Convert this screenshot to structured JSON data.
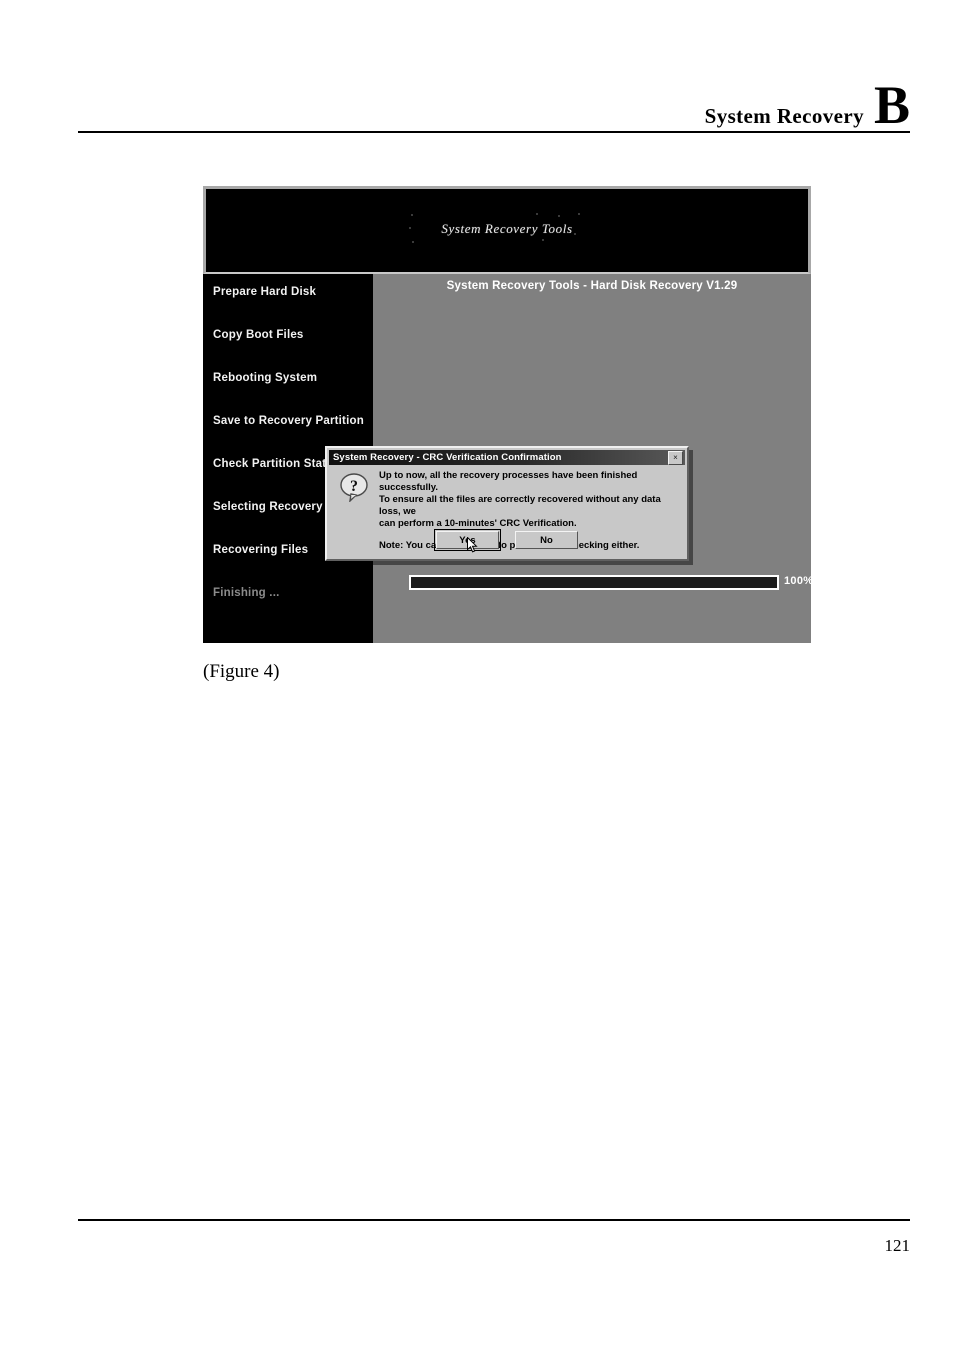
{
  "page": {
    "chapter_title": "System Recovery",
    "chapter_letter": "B",
    "figure_caption": "(Figure 4)",
    "page_number": "121"
  },
  "screenshot": {
    "banner_title": "System Recovery Tools",
    "content_heading": "System Recovery Tools - Hard Disk Recovery V1.29",
    "steps": [
      {
        "label": "Prepare Hard Disk",
        "state": "done"
      },
      {
        "label": "Copy Boot Files",
        "state": "done"
      },
      {
        "label": "Rebooting System",
        "state": "done"
      },
      {
        "label": "Save to Recovery Partition",
        "state": "done"
      },
      {
        "label": "Check Partition Status",
        "state": "done"
      },
      {
        "label": "Selecting Recovery Options",
        "state": "done"
      },
      {
        "label": "Recovering Files",
        "state": "done"
      },
      {
        "label": "Finishing ...",
        "state": "pending"
      }
    ],
    "progress": {
      "percent": 100,
      "label": "100%"
    },
    "dialog": {
      "title": "System Recovery - CRC Verification Confirmation",
      "close_label": "×",
      "icon": "question-mark-bubble",
      "body_line_1": "Up to now, all the recovery processes have been finished successfully.",
      "body_line_2": "To ensure all the files are correctly recovered without any data loss, we",
      "body_line_3": "can perform a 10-minutes' CRC Verification.",
      "note": "Note: You can choose not to perform this checking either.",
      "buttons": [
        {
          "label": "Yes",
          "default": true
        },
        {
          "label": "No",
          "default": false
        }
      ]
    }
  },
  "colors": {
    "banner_background": "#000000",
    "content_background": "#808080",
    "sidebar_background": "#000000",
    "dialog_face": "#c8c8c8",
    "dialog_titlebar": "#101010",
    "progress_fill": "#1c1c1c",
    "step_active_text": "#f2f2f2",
    "step_pending_text": "#8c8c8c"
  }
}
